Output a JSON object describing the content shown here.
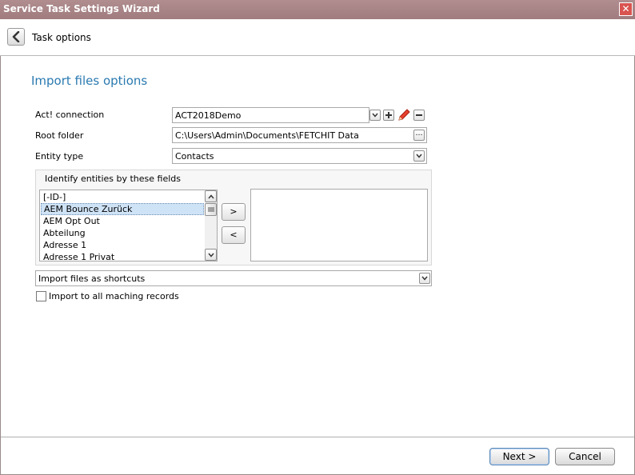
{
  "window": {
    "title": "Service Task Settings Wizard"
  },
  "header": {
    "title": "Task options"
  },
  "section": {
    "title": "Import files options"
  },
  "form": {
    "connection": {
      "label": "Act! connection",
      "value": "ACT2018Demo"
    },
    "root_folder": {
      "label": "Root folder",
      "value": "C:\\Users\\Admin\\Documents\\FETCHIT Data",
      "browse_label": "…"
    },
    "entity_type": {
      "label": "Entity type",
      "value": "Contacts"
    }
  },
  "identify": {
    "title": "Identify entities by these fields",
    "available_fields": [
      {
        "label": "[-ID-]"
      },
      {
        "label": "AEM Bounce Zurück",
        "selected": true
      },
      {
        "label": "AEM Opt Out"
      },
      {
        "label": "Abteilung"
      },
      {
        "label": "Adresse 1"
      },
      {
        "label": "Adresse 1 Privat"
      }
    ],
    "add_label": ">",
    "remove_label": "<",
    "selected_fields": []
  },
  "import_mode": {
    "value": "Import files as shortcuts"
  },
  "import_all": {
    "label": "Import to all maching records",
    "checked": false
  },
  "buttons": {
    "next": "Next >",
    "cancel": "Cancel"
  },
  "colors": {
    "title_bar": "#a88588",
    "accent": "#2a7ab0",
    "selection": "#cfe3f6"
  }
}
